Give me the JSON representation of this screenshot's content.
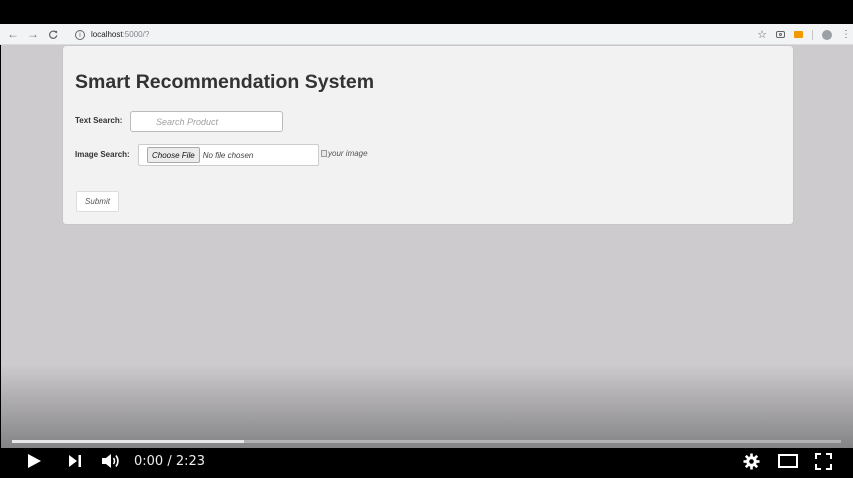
{
  "browser": {
    "url_host": "localhost",
    "url_path": ":5000/?"
  },
  "page": {
    "title": "Smart Recommendation System",
    "text_search_label": "Text Search:",
    "search_placeholder": "Search Product",
    "image_search_label": "Image Search:",
    "choose_file_label": "Choose File",
    "no_file_text": "No file chosen",
    "image_alt": "your image",
    "submit_label": "Submit"
  },
  "player": {
    "current_time": "0:00",
    "duration": "2:23",
    "time_display": "0:00 / 2:23",
    "progress_fraction": 0.28
  },
  "icons": [
    "back-icon",
    "forward-icon",
    "reload-icon",
    "info-icon",
    "star-icon",
    "camera-icon",
    "extension-icon",
    "profile-icon",
    "menu-icon",
    "play-icon",
    "next-icon",
    "volume-icon",
    "settings-icon",
    "theater-icon",
    "fullscreen-icon"
  ]
}
